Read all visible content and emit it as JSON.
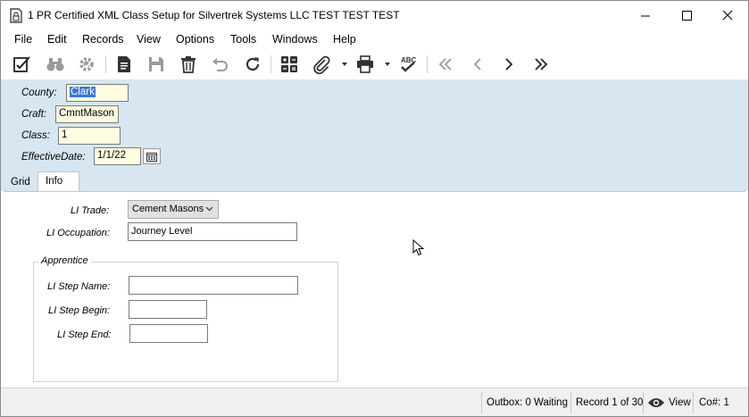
{
  "window": {
    "title": "1 PR Certified XML Class Setup for Silvertrek Systems LLC TEST TEST TEST",
    "icon": "document-lock-icon",
    "controls": {
      "minimize": "─",
      "maximize": "☐",
      "close": "✕"
    }
  },
  "menu": [
    "File",
    "Edit",
    "Records",
    "View",
    "Options",
    "Tools",
    "Windows",
    "Help"
  ],
  "toolbar": {
    "buttons": [
      "edit-checklist-icon",
      "binoculars-search-icon",
      "gear-settings-icon",
      "new-document-icon",
      "save-icon",
      "delete-trash-icon",
      "undo-icon",
      "refresh-icon",
      "calculator-icon",
      "attach-paperclip-icon",
      "print-icon",
      "spellcheck-icon",
      "first-record-icon",
      "previous-record-icon",
      "next-record-icon",
      "last-record-icon"
    ]
  },
  "header": {
    "county_label": "County:",
    "county_value": "Clark",
    "craft_label": "Craft:",
    "craft_value": "CmntMason",
    "class_label": "Class:",
    "class_value": "1",
    "effective_label": "EffectiveDate:",
    "effective_value": "1/1/22"
  },
  "tabs": {
    "grid": "Grid",
    "info": "Info",
    "active": "Info"
  },
  "info": {
    "li_trade_label": "LI Trade:",
    "li_trade_value": "Cement Masons",
    "li_occupation_label": "LI Occupation:",
    "li_occupation_value": "Journey Level",
    "apprentice_title": "Apprentice",
    "step_name_label": "LI Step Name:",
    "step_name_value": "",
    "step_begin_label": "LI Step Begin:",
    "step_begin_value": "",
    "step_end_label": "LI Step End:",
    "step_end_value": ""
  },
  "status": {
    "outbox": "Outbox: 0 Waiting",
    "record": "Record 1 of 30",
    "view": "View",
    "company": "Co#: 1"
  },
  "colors": {
    "header_bg": "#d7e6f0",
    "required_field_bg": "#fffde0",
    "selection": "#3b78d8",
    "statusbar_bg": "#f0f0f0"
  }
}
